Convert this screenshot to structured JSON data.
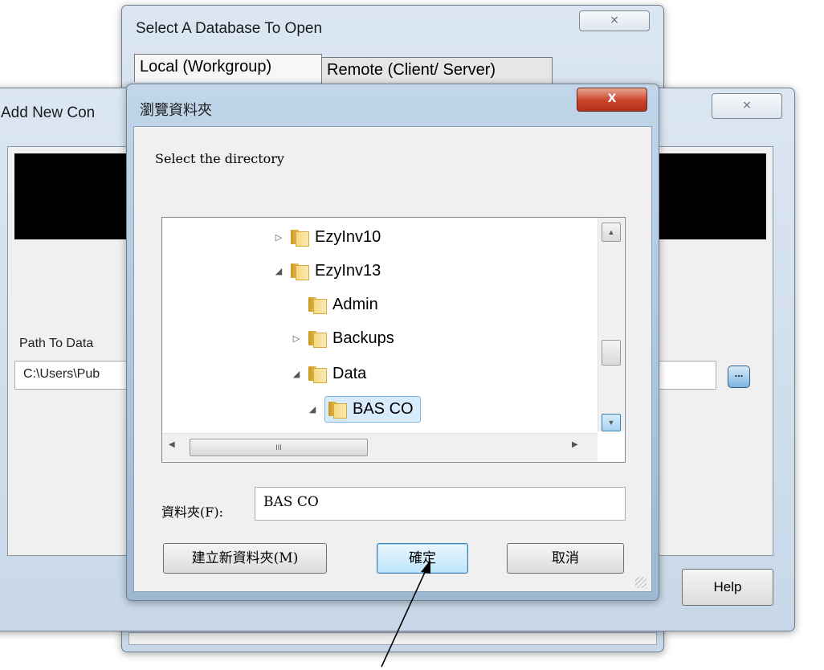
{
  "colors": {
    "accent": "#3c7fb1",
    "close_red": "#c9452a",
    "black_panel": "#000000"
  },
  "select_db_window": {
    "title": "Select A  Database To Open",
    "close_glyph": "⨯",
    "tabs": [
      "Local (Workgroup)",
      "Remote (Client/ Server)"
    ]
  },
  "add_new_window": {
    "title": "Add New Con",
    "close_glyph": "⨯",
    "path_label": "Path To Data",
    "path_value": "C:\\Users\\Pub",
    "browse_glyph": "...",
    "help_label": "Help"
  },
  "browse_dialog": {
    "title": "瀏覽資料夾",
    "close_glyph": "X",
    "prompt": "Select the directory",
    "tree": [
      {
        "label": "EzyInv10",
        "arrow": "▷"
      },
      {
        "label": "EzyInv13",
        "arrow": "◢"
      },
      {
        "label": "Admin",
        "arrow": ""
      },
      {
        "label": "Backups",
        "arrow": "▷"
      },
      {
        "label": "Data",
        "arrow": "◢"
      },
      {
        "label": "BAS CO",
        "arrow": "◢"
      }
    ],
    "hscroll_thumb": "III",
    "folder_label": "資料夾(F):",
    "folder_value": "BAS CO",
    "new_folder_button": "建立新資料夾(M)",
    "ok_button": "確定",
    "cancel_button": "取消",
    "icons": {
      "expand": "triangle-right-icon",
      "collapse": "triangle-down-icon",
      "folder": "folder-icon"
    }
  }
}
